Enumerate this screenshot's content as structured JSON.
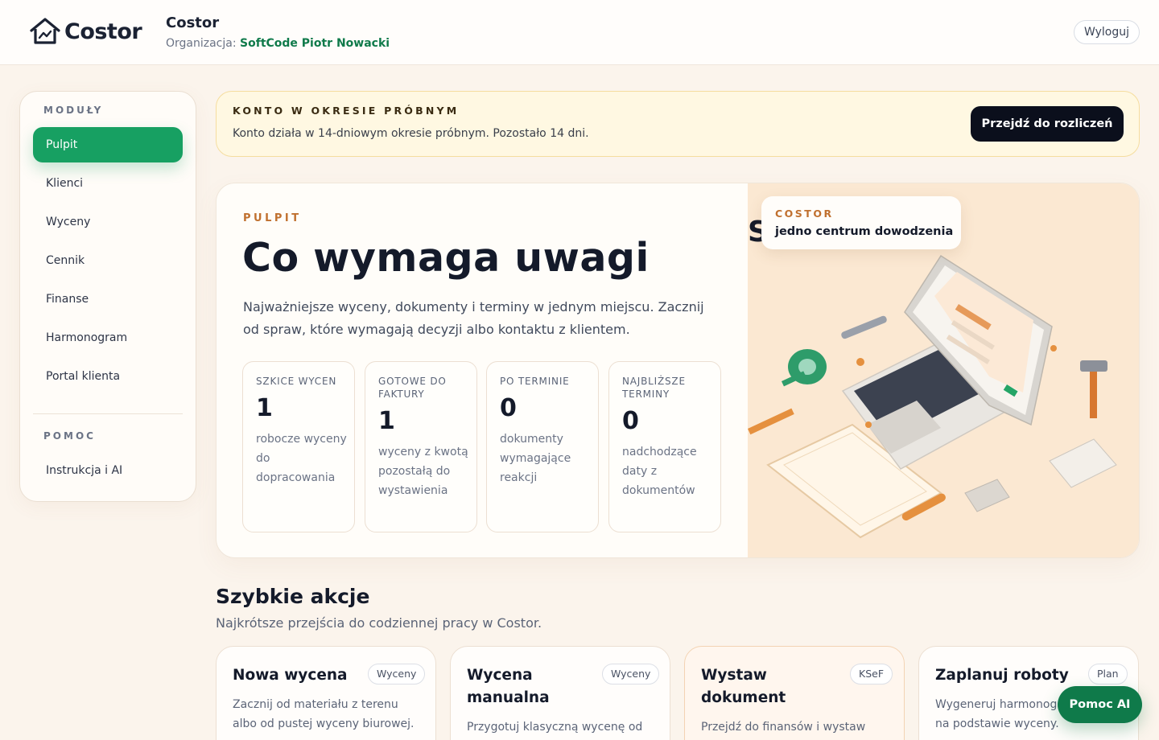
{
  "header": {
    "logo_text": "Costor",
    "app_title": "Costor",
    "org_label": "Organizacja:",
    "org_name": "SoftCode Piotr Nowacki",
    "logout_label": "Wyloguj"
  },
  "sidebar": {
    "modules_heading": "MODUŁY",
    "items": [
      {
        "label": "Pulpit",
        "active": true
      },
      {
        "label": "Klienci"
      },
      {
        "label": "Wyceny"
      },
      {
        "label": "Cennik"
      },
      {
        "label": "Finanse"
      },
      {
        "label": "Harmonogram"
      },
      {
        "label": "Portal klienta"
      }
    ],
    "help_heading": "POMOC",
    "help_items": [
      {
        "label": "Instrukcja i AI"
      }
    ]
  },
  "trial": {
    "title": "KONTO W OKRESIE PRÓBNYM",
    "text": "Konto działa w 14-dniowym okresie próbnym. Pozostało 14 dni.",
    "button_label": "Przejdź do rozliczeń"
  },
  "hero": {
    "eyebrow": "PULPIT",
    "title": "Co wymaga uwagi",
    "description": "Najważniejsze wyceny, dokumenty i terminy w jednym miejscu. Zacznij od spraw, które wymagają decyzji albo kontaktu z klientem.",
    "stats": [
      {
        "label": "SZKICE WYCEN",
        "value": "1",
        "desc": "robocze wyceny do dopracowania"
      },
      {
        "label": "GOTOWE DO FAKTURY",
        "value": "1",
        "desc": "wyceny z kwotą pozostałą do wystawienia"
      },
      {
        "label": "PO TERMINIE",
        "value": "0",
        "desc": "dokumenty wymagające reakcji"
      },
      {
        "label": "NAJBLIŻSZE TERMINY",
        "value": "0",
        "desc": "nadchodzące daty z dokumentów"
      }
    ],
    "art_fragment": "S",
    "art_badge_title": "COSTOR",
    "art_badge_subtitle": "jedno centrum dowodzenia"
  },
  "quick_actions": {
    "title": "Szybkie akcje",
    "subtitle": "Najkrótsze przejścia do codziennej pracy w Costor.",
    "cards": [
      {
        "name": "Nowa wycena",
        "tag": "Wyceny",
        "desc": "Zacznij od materiału z terenu albo od pustej wyceny biurowej."
      },
      {
        "name": "Wycena manualna",
        "tag": "Wyceny",
        "desc": "Przygotuj klasyczną wycenę od"
      },
      {
        "name": "Wystaw dokument",
        "tag": "KSeF",
        "desc": "Przejdź do finansów i wystaw"
      },
      {
        "name": "Zaplanuj roboty",
        "tag": "Plan",
        "desc": "Wygeneruj harmonogram na podstawie wyceny."
      }
    ]
  },
  "help_fab_label": "Pomoc AI",
  "colors": {
    "brand_green": "#17a062",
    "dark_green": "#0f7a4a",
    "accent_orange": "#c0702f",
    "trial_bg": "#fff8e2",
    "page_bg": "#fbf4ec"
  }
}
